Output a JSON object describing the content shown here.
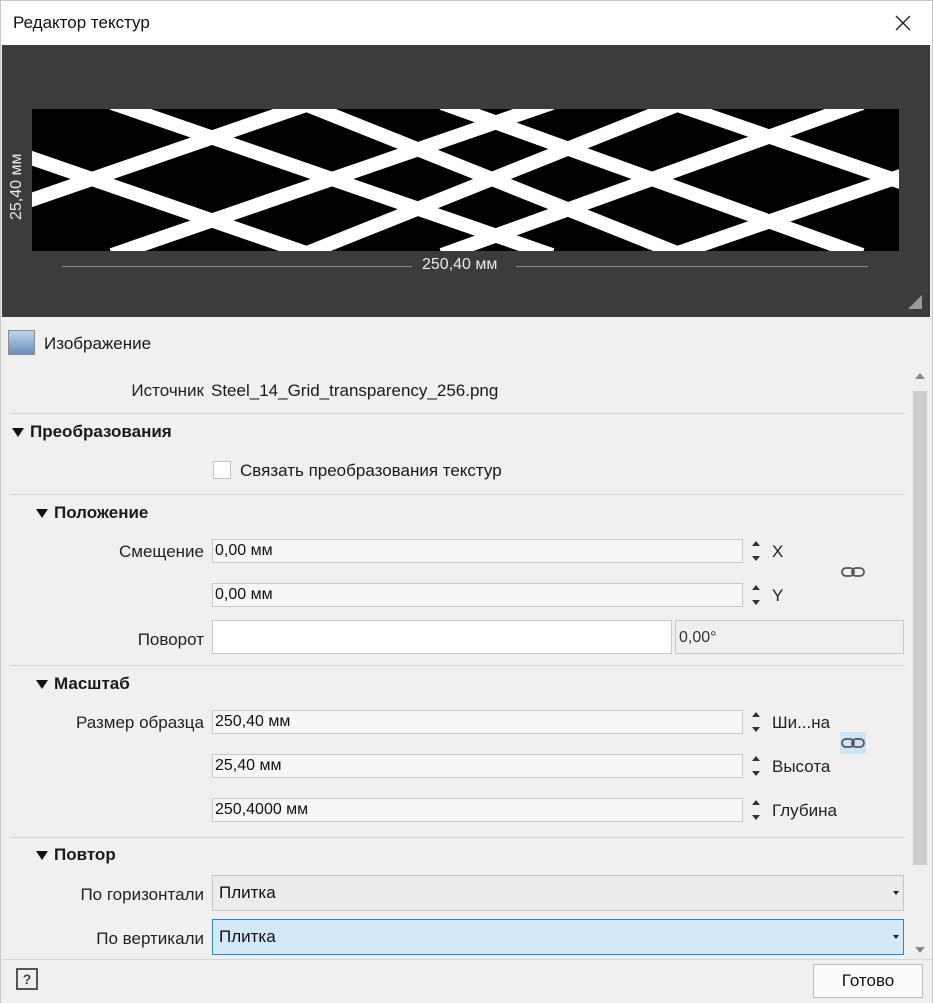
{
  "window": {
    "title": "Редактор текстур"
  },
  "preview": {
    "height_label": "25,40 мм",
    "width_label": "250,40 мм"
  },
  "image_section": {
    "label": "Изображение",
    "icon": "image-icon"
  },
  "source": {
    "label": "Источник",
    "value": "Steel_14_Grid_transparency_256.png"
  },
  "transforms": {
    "header": "Преобразования",
    "link_checkbox": {
      "label": "Связать преобразования текстур",
      "checked": false
    }
  },
  "position": {
    "header": "Положение",
    "offset_label": "Смещение",
    "offset_x": "0,00 мм",
    "offset_y": "0,00 мм",
    "x_axis": "X",
    "y_axis": "Y",
    "rotation_label": "Поворот",
    "rotation_value": "0,00°"
  },
  "scale": {
    "header": "Масштаб",
    "sample_size_label": "Размер образца",
    "width_value": "250,40 мм",
    "width_axis": "Ши...на",
    "height_value": "25,40 мм",
    "height_axis": "Высота",
    "depth_value": "250,4000 мм",
    "depth_axis": "Глубина"
  },
  "repeat": {
    "header": "Повтор",
    "horizontal_label": "По горизонтали",
    "horizontal_value": "Плитка",
    "vertical_label": "По вертикали",
    "vertical_value": "Плитка"
  },
  "footer": {
    "help_label": "?",
    "done_label": "Готово"
  },
  "colors": {
    "preview_bg": "#3c3c3c",
    "focus_blue": "#1e8ad6",
    "selection_bg": "#d3e9f8"
  }
}
